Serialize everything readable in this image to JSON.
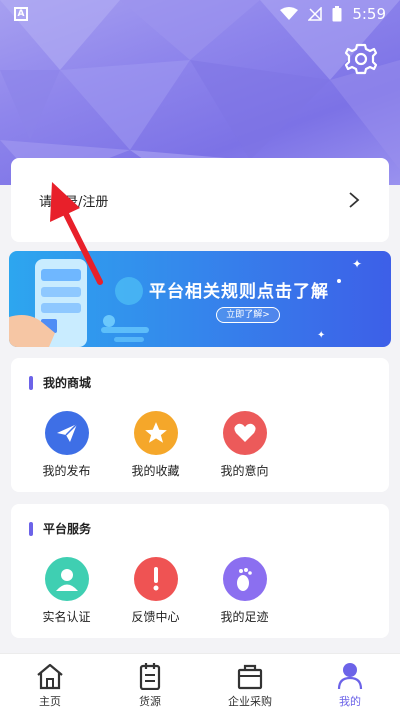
{
  "status_bar": {
    "time": "5:59",
    "notification_icon": "A"
  },
  "header": {
    "settings_icon": "gear-icon"
  },
  "login": {
    "label": "请登录/注册"
  },
  "banner": {
    "title": "平台相关规则点击了解",
    "button_label": "立即了解>"
  },
  "my_mall": {
    "title": "我的商城",
    "items": [
      {
        "label": "我的发布",
        "icon": "paper-plane-icon",
        "color": "#3e6fe6"
      },
      {
        "label": "我的收藏",
        "icon": "star-icon",
        "color": "#f5a72a"
      },
      {
        "label": "我的意向",
        "icon": "heart-icon",
        "color": "#ec5a5a"
      }
    ]
  },
  "platform_services": {
    "title": "平台服务",
    "items": [
      {
        "label": "实名认证",
        "icon": "user-icon",
        "color": "#3fcfb2"
      },
      {
        "label": "反馈中心",
        "icon": "exclamation-icon",
        "color": "#ef5353"
      },
      {
        "label": "我的足迹",
        "icon": "footprint-icon",
        "color": "#8b6ff0"
      }
    ]
  },
  "tabbar": {
    "tabs": [
      {
        "label": "主页",
        "icon": "home-icon"
      },
      {
        "label": "货源",
        "icon": "clipboard-icon"
      },
      {
        "label": "企业采购",
        "icon": "shopping-bag-icon"
      },
      {
        "label": "我的",
        "icon": "profile-icon",
        "active": true
      }
    ]
  },
  "colors": {
    "accent": "#6c63e8",
    "header": "#8f86ec",
    "banner": "#3489ec"
  }
}
